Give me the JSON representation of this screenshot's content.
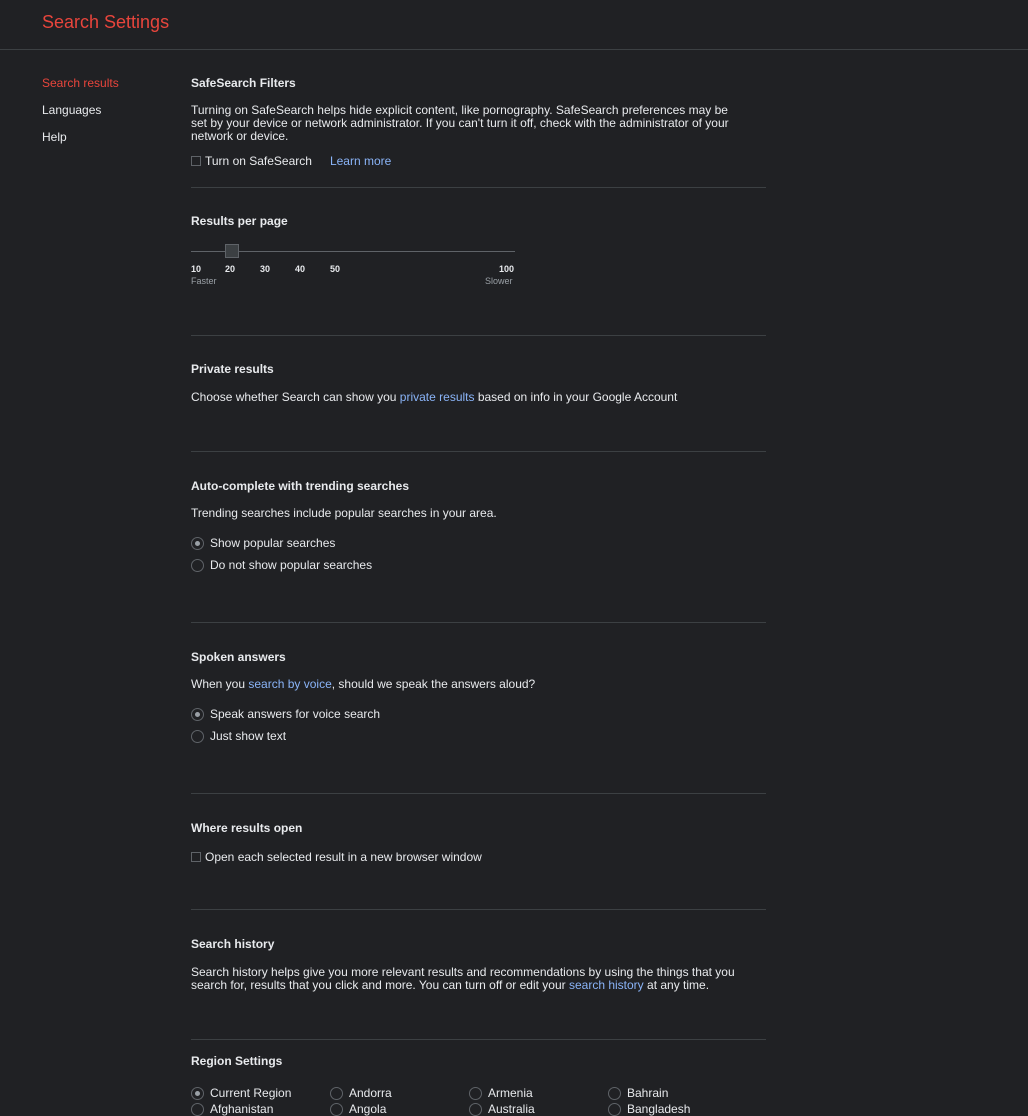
{
  "header": {
    "title": "Search Settings"
  },
  "nav": {
    "items": [
      {
        "label": "Search results"
      },
      {
        "label": "Languages"
      },
      {
        "label": "Help"
      }
    ]
  },
  "safesearch": {
    "title": "SafeSearch Filters",
    "desc": "Turning on SafeSearch helps hide explicit content, like pornography. SafeSearch preferences may be set by your device or network administrator. If you can't turn it off, check with the administrator of your network or device.",
    "checkbox_label": "Turn on SafeSearch",
    "checked": false,
    "learn_more": "Learn more"
  },
  "results_per_page": {
    "title": "Results per page",
    "ticks": [
      "10",
      "20",
      "30",
      "40",
      "50",
      "100"
    ],
    "selected": "20",
    "left_caption": "Faster",
    "right_caption": "Slower"
  },
  "private_results": {
    "title": "Private results",
    "desc_before": "Choose whether Search can show you ",
    "link": "private results",
    "desc_after": " based on info in your Google Account"
  },
  "autocomplete": {
    "title": "Auto-complete with trending searches",
    "desc": "Trending searches include popular searches in your area.",
    "options": [
      {
        "label": "Show popular searches",
        "checked": true
      },
      {
        "label": "Do not show popular searches",
        "checked": false
      }
    ]
  },
  "spoken": {
    "title": "Spoken answers",
    "desc_before": "When you ",
    "link": "search by voice",
    "desc_after": ", should we speak the answers aloud?",
    "options": [
      {
        "label": "Speak answers for voice search",
        "checked": true
      },
      {
        "label": "Just show text",
        "checked": false
      }
    ]
  },
  "results_open": {
    "title": "Where results open",
    "checkbox_label": "Open each selected result in a new browser window",
    "checked": false
  },
  "history": {
    "title": "Search history",
    "desc_before": "Search history helps give you more relevant results and recommendations by using the things that you search for, results that you click and more. You can turn off or edit your ",
    "link": "search history",
    "desc_after": " at any time."
  },
  "region": {
    "title": "Region Settings",
    "options": [
      {
        "label": "Current Region",
        "checked": true
      },
      {
        "label": "Andorra",
        "checked": false
      },
      {
        "label": "Armenia",
        "checked": false
      },
      {
        "label": "Bahrain",
        "checked": false
      },
      {
        "label": "Afghanistan",
        "checked": false
      },
      {
        "label": "Angola",
        "checked": false
      },
      {
        "label": "Australia",
        "checked": false
      },
      {
        "label": "Bangladesh",
        "checked": false
      }
    ]
  },
  "colors": {
    "background": "#202124",
    "accent_red": "#e8453c",
    "link_blue": "#8ab4f8",
    "text": "#e8eaed",
    "divider": "#3c4043"
  }
}
